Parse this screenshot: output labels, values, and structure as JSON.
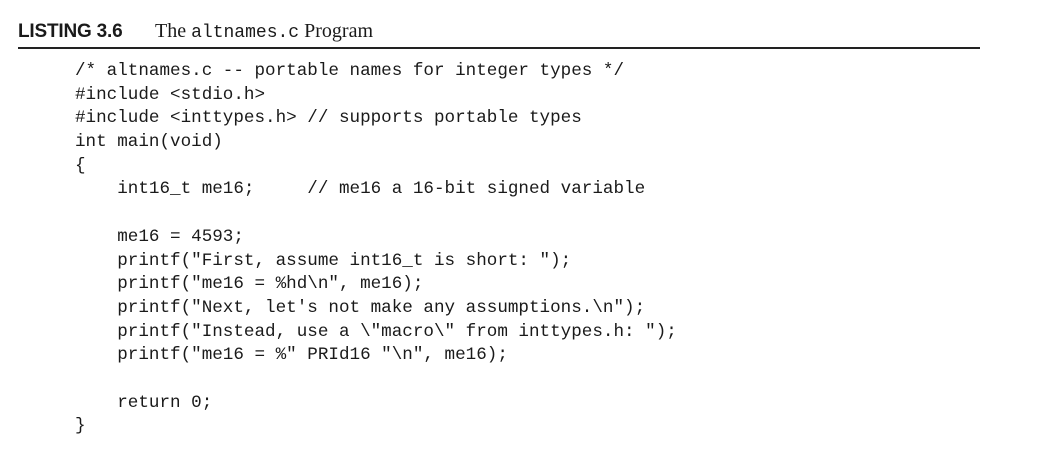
{
  "header": {
    "label": "LISTING 3.6",
    "title_prefix": "The ",
    "title_code": "altnames.c",
    "title_suffix": " Program"
  },
  "code_lines": [
    "/* altnames.c -- portable names for integer types */",
    "#include <stdio.h>",
    "#include <inttypes.h> // supports portable types",
    "int main(void)",
    "{",
    "    int16_t me16;     // me16 a 16-bit signed variable",
    "",
    "    me16 = 4593;",
    "    printf(\"First, assume int16_t is short: \");",
    "    printf(\"me16 = %hd\\n\", me16);",
    "    printf(\"Next, let's not make any assumptions.\\n\");",
    "    printf(\"Instead, use a \\\"macro\\\" from inttypes.h: \");",
    "    printf(\"me16 = %\" PRId16 \"\\n\", me16);",
    "",
    "    return 0;",
    "}"
  ]
}
